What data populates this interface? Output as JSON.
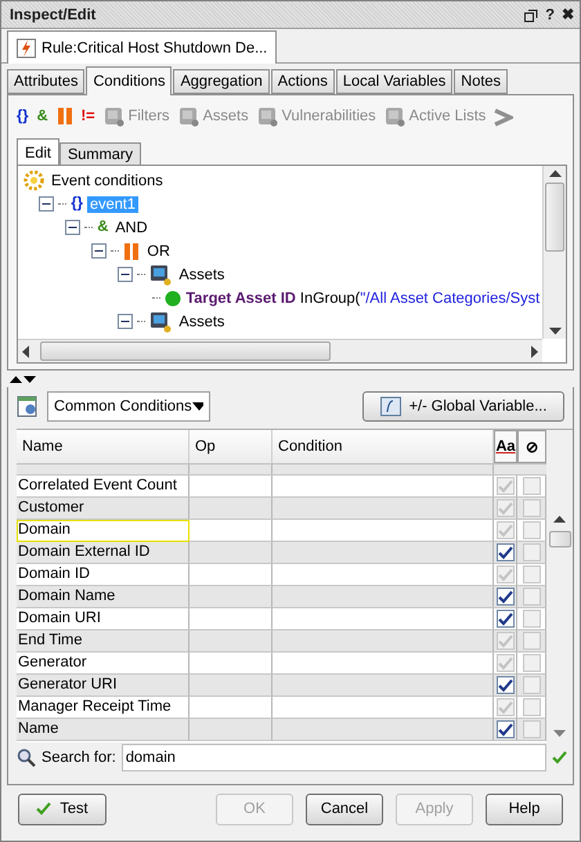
{
  "window": {
    "title": "Inspect/Edit",
    "buttons": [
      "?",
      "✖"
    ]
  },
  "document_tab": {
    "label": "Rule:Critical Host Shutdown De..."
  },
  "tabs": [
    {
      "label": "Attributes",
      "selected": false
    },
    {
      "label": "Conditions",
      "selected": true
    },
    {
      "label": "Aggregation",
      "selected": false
    },
    {
      "label": "Actions",
      "selected": false
    },
    {
      "label": "Local Variables",
      "selected": false
    },
    {
      "label": "Notes",
      "selected": false
    }
  ],
  "toolbar": [
    {
      "kind": "glyph",
      "glyph": "{}",
      "color": "#1030d0"
    },
    {
      "kind": "glyph",
      "glyph": "&",
      "color": "#3a8a1a"
    },
    {
      "kind": "or"
    },
    {
      "kind": "glyph",
      "glyph": "!=",
      "color": "#e01010"
    },
    {
      "kind": "button",
      "label": "Filters",
      "disabled": true
    },
    {
      "kind": "button",
      "label": "Assets",
      "disabled": true
    },
    {
      "kind": "button",
      "label": "Vulnerabilities",
      "disabled": true
    },
    {
      "kind": "button",
      "label": "Active Lists",
      "disabled": true
    },
    {
      "kind": "more"
    }
  ],
  "subtabs": [
    {
      "label": "Edit",
      "selected": true
    },
    {
      "label": "Summary",
      "selected": false
    }
  ],
  "tree": {
    "kind": "root",
    "label": "Event conditions",
    "children": [
      {
        "kind": "event",
        "glyph": "{}",
        "label": "event1",
        "selected": true,
        "expanded": true,
        "children": [
          {
            "kind": "and",
            "glyph": "&",
            "label": "AND",
            "selected": false,
            "expanded": true,
            "children": [
              {
                "kind": "or",
                "label": "OR",
                "selected": false,
                "expanded": true,
                "children": [
                  {
                    "kind": "assets",
                    "label": "Assets",
                    "selected": false,
                    "expanded": true,
                    "children": [
                      {
                        "kind": "condition",
                        "field": "Target Asset ID",
                        "operator": "InGroup(",
                        "value": "\"/All Asset Categories/Syst",
                        "selected": false
                      }
                    ]
                  },
                  {
                    "kind": "assets",
                    "label": "Assets",
                    "selected": false,
                    "expanded": true
                  }
                ]
              }
            ]
          }
        ]
      }
    ]
  },
  "conditions_selector": {
    "value": "Common Conditions"
  },
  "global_variable_button": {
    "label": "+/- Global Variable..."
  },
  "table": {
    "columns": [
      "Name",
      "Op",
      "Condition",
      "Aa",
      "⊘"
    ],
    "rows": [
      {
        "name": "Correlated Event Count",
        "case_sensitive": false,
        "negate": false,
        "selected": false
      },
      {
        "name": "Customer",
        "case_sensitive": false,
        "negate": false,
        "selected": false
      },
      {
        "name": "Domain",
        "case_sensitive": false,
        "negate": false,
        "selected": true
      },
      {
        "name": "Domain External ID",
        "case_sensitive": true,
        "negate": false,
        "selected": false
      },
      {
        "name": "Domain ID",
        "case_sensitive": false,
        "negate": false,
        "selected": false
      },
      {
        "name": "Domain Name",
        "case_sensitive": true,
        "negate": false,
        "selected": false
      },
      {
        "name": "Domain URI",
        "case_sensitive": true,
        "negate": false,
        "selected": false
      },
      {
        "name": "End Time",
        "case_sensitive": false,
        "negate": false,
        "selected": false
      },
      {
        "name": "Generator",
        "case_sensitive": false,
        "negate": false,
        "selected": false
      },
      {
        "name": "Generator URI",
        "case_sensitive": true,
        "negate": false,
        "selected": false
      },
      {
        "name": "Manager Receipt Time",
        "case_sensitive": false,
        "negate": false,
        "selected": false
      },
      {
        "name": "Name",
        "case_sensitive": true,
        "negate": false,
        "selected": false
      }
    ]
  },
  "search": {
    "label": "Search for:",
    "value": "domain"
  },
  "buttons": [
    {
      "label": "Test",
      "kind": "test",
      "disabled": false
    },
    {
      "label": "OK",
      "kind": "plain",
      "disabled": true
    },
    {
      "label": "Cancel",
      "kind": "plain",
      "disabled": false
    },
    {
      "label": "Apply",
      "kind": "plain",
      "disabled": true
    },
    {
      "label": "Help",
      "kind": "plain",
      "disabled": false
    }
  ]
}
